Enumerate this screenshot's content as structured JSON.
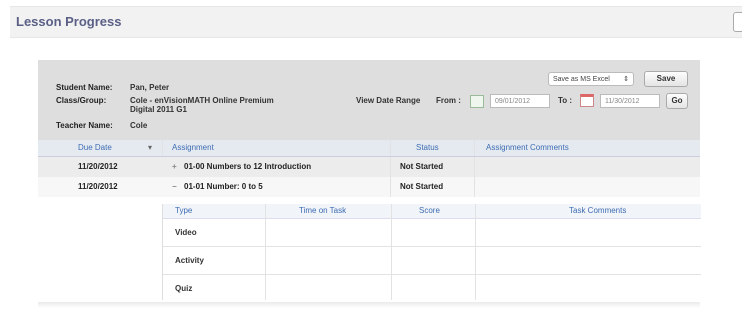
{
  "page": {
    "title": "Lesson Progress"
  },
  "student": {
    "name_label": "Student Name:",
    "name_value": "Pan, Peter",
    "class_label": "Class/Group:",
    "class_value_line1": "Cole - enVisionMATH Online Premium",
    "class_value_line2": "Digital 2011 G1",
    "teacher_label": "Teacher Name:",
    "teacher_value": "Cole"
  },
  "export": {
    "select_value": "Save as MS Excel",
    "save_label": "Save"
  },
  "date_range": {
    "label": "View Date Range",
    "from_label": "From :",
    "from_value": "09/01/2012",
    "to_label": "To :",
    "to_value": "11/30/2012",
    "go_label": "Go"
  },
  "table": {
    "headers": {
      "due_date": "Due Date",
      "assignment": "Assignment",
      "status": "Status",
      "comments": "Assignment Comments"
    },
    "rows": [
      {
        "date": "11/20/2012",
        "toggle": "+",
        "assignment": "01-00 Numbers to 12 Introduction",
        "status": "Not Started"
      },
      {
        "date": "11/20/2012",
        "toggle": "−",
        "assignment": "01-01 Number: 0 to 5",
        "status": "Not Started"
      }
    ]
  },
  "subtable": {
    "headers": {
      "type": "Type",
      "time": "Time on Task",
      "score": "Score",
      "comments": "Task Comments"
    },
    "rows": [
      {
        "type": "Video"
      },
      {
        "type": "Activity"
      },
      {
        "type": "Quiz"
      }
    ]
  }
}
